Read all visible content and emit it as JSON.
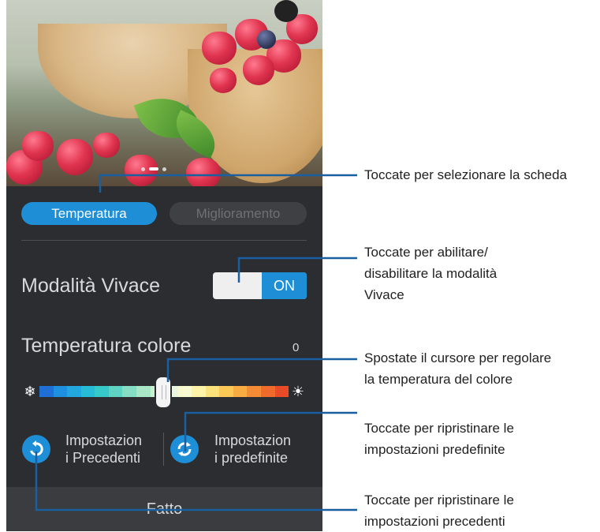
{
  "tabs": {
    "temperature": "Temperatura",
    "enhancement": "Miglioramento"
  },
  "vivid_mode": {
    "label": "Modalità Vivace",
    "toggle_state": "ON"
  },
  "color_temperature": {
    "label": "Temperatura colore",
    "value": "0",
    "slider_fraction": 0.5
  },
  "actions": {
    "previous_settings": "Impostazion\ni Precedenti",
    "default_settings": "Impostazion\ni predefinite",
    "done": "Fatto"
  },
  "callouts": {
    "select_tab": "Toccate per selezionare la scheda",
    "enable_vivid": "Toccate per abilitare/\ndisabilitare la modalità\nVivace",
    "move_slider": "Spostate il cursore per regolare\nla temperatura del colore",
    "restore_defaults": "Toccate per ripristinare le\nimpostazioni predefinite",
    "restore_previous": "Toccate per ripristinare le\nimpostazioni precedenti"
  },
  "colors": {
    "accent": "#1e8ed6",
    "panel": "#2b2d30",
    "callout_line": "#1a5fa0",
    "gradient": [
      "#1e6fd6",
      "#1f8fe0",
      "#22a7de",
      "#26bcd5",
      "#35c9c9",
      "#5ed3c4",
      "#85ddc3",
      "#a8e6c6",
      "#c6eecf",
      "#e9f7e0",
      "#fafad0",
      "#fff3a8",
      "#fde27c",
      "#fcc959",
      "#f9ac44",
      "#f68b35",
      "#f06a2c",
      "#ea4b27"
    ]
  },
  "icons": {
    "cold": "snowflake-icon",
    "warm": "sun-icon",
    "previous": "undo-icon",
    "default": "refresh-icon"
  }
}
